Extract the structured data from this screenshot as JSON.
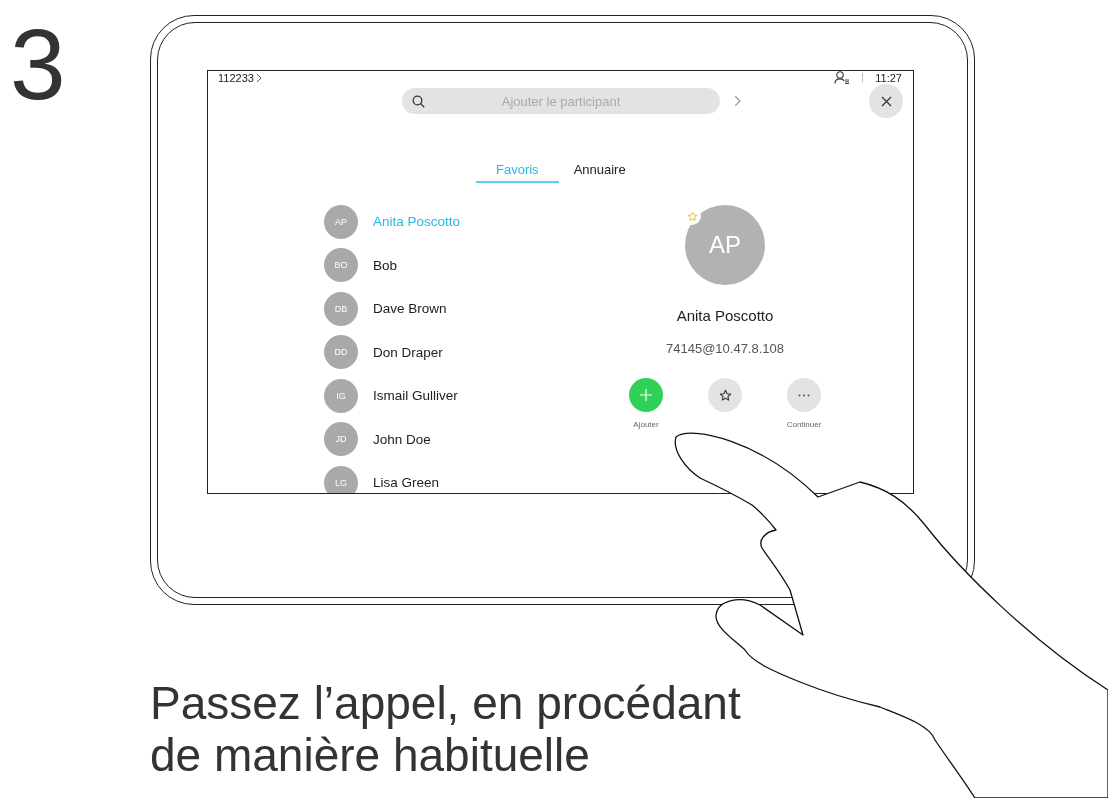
{
  "step": "3",
  "screen": {
    "breadcrumb": "112233",
    "time": "11:27",
    "search": {
      "placeholder": "Ajouter le participant"
    },
    "tabs": [
      {
        "label": "Favoris",
        "selected": true
      },
      {
        "label": "Annuaire",
        "selected": false
      }
    ],
    "contacts": [
      {
        "initials": "AP",
        "name": "Anita Poscotto",
        "selected": true
      },
      {
        "initials": "BO",
        "name": "Bob",
        "selected": false
      },
      {
        "initials": "DB",
        "name": "Dave Brown",
        "selected": false
      },
      {
        "initials": "DD",
        "name": "Don Draper",
        "selected": false
      },
      {
        "initials": "IG",
        "name": "Ismail Gulliver",
        "selected": false
      },
      {
        "initials": "JD",
        "name": "John Doe",
        "selected": false
      },
      {
        "initials": "LG",
        "name": "Lisa Green",
        "selected": false
      }
    ],
    "detail": {
      "initials": "AP",
      "favorite": true,
      "name": "Anita Poscotto",
      "address": "74145@10.47.8.108",
      "actions": [
        {
          "kind": "add",
          "label": "Ajouter"
        },
        {
          "kind": "favorite"
        },
        {
          "kind": "more",
          "label": "Continuer"
        }
      ]
    }
  },
  "caption": [
    "Passez l’appel, en procédant",
    "de manière habituelle"
  ]
}
